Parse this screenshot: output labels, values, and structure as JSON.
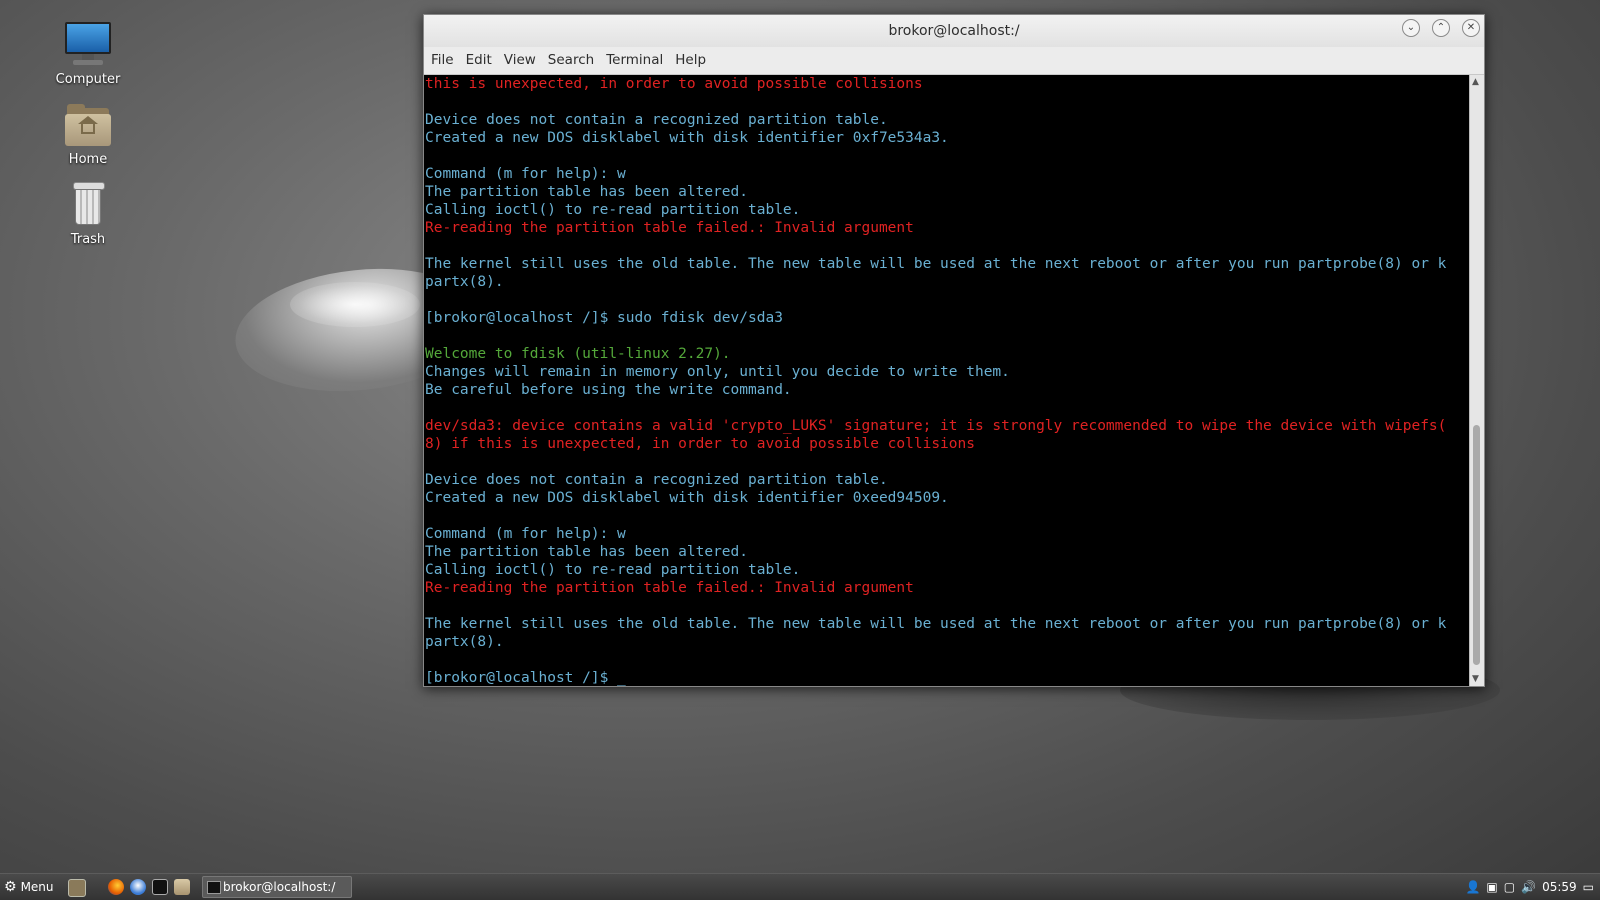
{
  "desktop": {
    "icons": [
      {
        "label": "Computer",
        "icon": "computer-icon"
      },
      {
        "label": "Home",
        "icon": "home-folder-icon"
      },
      {
        "label": "Trash",
        "icon": "trash-icon"
      }
    ]
  },
  "window": {
    "title": "brokor@localhost:/",
    "controls": [
      "minimize",
      "maximize",
      "close"
    ],
    "menu": [
      "File",
      "Edit",
      "View",
      "Search",
      "Terminal",
      "Help"
    ]
  },
  "terminal": {
    "lines": [
      {
        "text": "this is unexpected, in order to avoid possible collisions",
        "color": "red"
      },
      {
        "text": "",
        "color": "cyan"
      },
      {
        "text": "Device does not contain a recognized partition table.",
        "color": "cyan"
      },
      {
        "text": "Created a new DOS disklabel with disk identifier 0xf7e534a3.",
        "color": "cyan"
      },
      {
        "text": "",
        "color": "cyan"
      },
      {
        "text": "Command (m for help): w",
        "color": "cyan"
      },
      {
        "text": "The partition table has been altered.",
        "color": "cyan"
      },
      {
        "text": "Calling ioctl() to re-read partition table.",
        "color": "cyan"
      },
      {
        "text": "Re-reading the partition table failed.: Invalid argument",
        "color": "red"
      },
      {
        "text": "",
        "color": "cyan"
      },
      {
        "text": "The kernel still uses the old table. The new table will be used at the next reboot or after you run partprobe(8) or k",
        "color": "cyan"
      },
      {
        "text": "partx(8).",
        "color": "cyan"
      },
      {
        "text": "",
        "color": "cyan"
      },
      {
        "text": "[brokor@localhost /]$ sudo fdisk dev/sda3",
        "color": "cyan"
      },
      {
        "text": "",
        "color": "cyan"
      },
      {
        "text": "Welcome to fdisk (util-linux 2.27).",
        "color": "green"
      },
      {
        "text": "Changes will remain in memory only, until you decide to write them.",
        "color": "cyan"
      },
      {
        "text": "Be careful before using the write command.",
        "color": "cyan"
      },
      {
        "text": "",
        "color": "cyan"
      },
      {
        "text": "dev/sda3: device contains a valid 'crypto_LUKS' signature; it is strongly recommended to wipe the device with wipefs(",
        "color": "red"
      },
      {
        "text": "8) if this is unexpected, in order to avoid possible collisions",
        "color": "red"
      },
      {
        "text": "",
        "color": "cyan"
      },
      {
        "text": "Device does not contain a recognized partition table.",
        "color": "cyan"
      },
      {
        "text": "Created a new DOS disklabel with disk identifier 0xeed94509.",
        "color": "cyan"
      },
      {
        "text": "",
        "color": "cyan"
      },
      {
        "text": "Command (m for help): w",
        "color": "cyan"
      },
      {
        "text": "The partition table has been altered.",
        "color": "cyan"
      },
      {
        "text": "Calling ioctl() to re-read partition table.",
        "color": "cyan"
      },
      {
        "text": "Re-reading the partition table failed.: Invalid argument",
        "color": "red"
      },
      {
        "text": "",
        "color": "cyan"
      },
      {
        "text": "The kernel still uses the old table. The new table will be used at the next reboot or after you run partprobe(8) or k",
        "color": "cyan"
      },
      {
        "text": "partx(8).",
        "color": "cyan"
      },
      {
        "text": "",
        "color": "cyan"
      },
      {
        "text": "[brokor@localhost /]$ _",
        "color": "cyan"
      }
    ],
    "colors": {
      "cyan": "#6ab0d2",
      "red": "#e02222",
      "green": "#54a83a",
      "background": "#000000"
    }
  },
  "taskbar": {
    "menu_label": "Menu",
    "quick_launch": [
      "camera-icon",
      "firefox-icon",
      "thunderbird-icon",
      "terminal-icon",
      "files-icon"
    ],
    "task_label": "brokor@localhost:/",
    "tray_icons": [
      "user-icon",
      "network-icon",
      "storage-icon",
      "volume-icon"
    ],
    "clock": "05:59"
  }
}
